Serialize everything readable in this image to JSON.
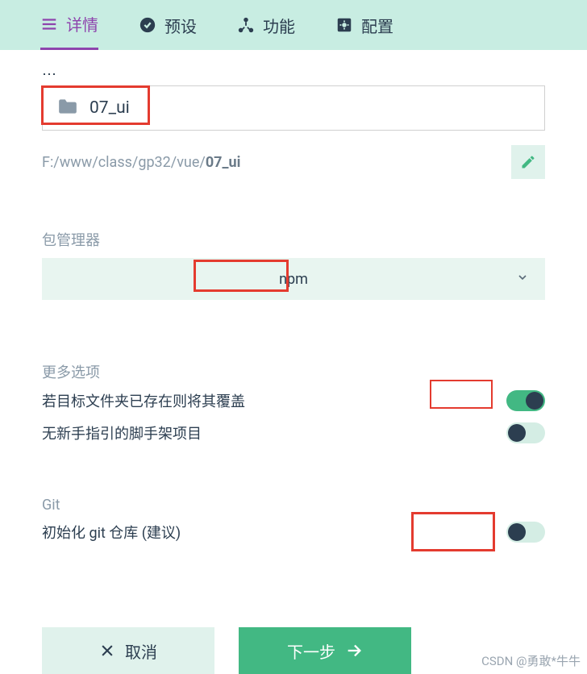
{
  "tabs": {
    "details": "详情",
    "preset": "预设",
    "features": "功能",
    "config": "配置"
  },
  "folder": {
    "name": "07_ui",
    "path_prefix": "F:/www/class/gp32/vue/",
    "path_bold": "07_ui"
  },
  "packageManager": {
    "label": "包管理器",
    "value": "npm"
  },
  "moreOptions": {
    "label": "更多选项",
    "overwrite": "若目标文件夹已存在则将其覆盖",
    "noGuide": "无新手指引的脚手架项目"
  },
  "git": {
    "label": "Git",
    "init": "初始化 git 仓库 (建议)"
  },
  "buttons": {
    "cancel": "取消",
    "next": "下一步"
  },
  "watermark": "CSDN @勇敢*牛牛"
}
